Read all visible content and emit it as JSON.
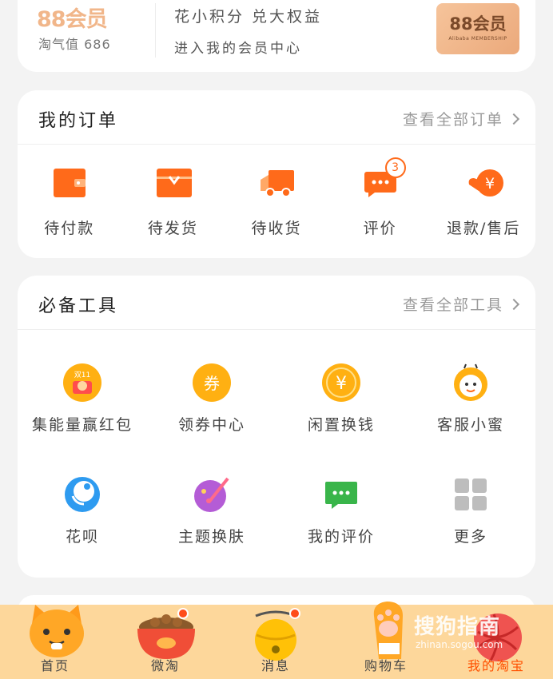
{
  "member": {
    "logo": "88会员",
    "value_text": "淘气值 686",
    "line1": "花小积分 兑大权益",
    "line2": "进入我的会员中心",
    "badge_title": "88会员",
    "badge_sub": "Alibaba MEMBERSHIP"
  },
  "orders": {
    "title": "我的订单",
    "view_all": "查看全部订单",
    "items": [
      {
        "label": "待付款",
        "icon": "wallet-icon"
      },
      {
        "label": "待发货",
        "icon": "package-icon"
      },
      {
        "label": "待收货",
        "icon": "truck-icon"
      },
      {
        "label": "评价",
        "icon": "comment-icon",
        "badge": "3"
      },
      {
        "label": "退款/售后",
        "icon": "refund-icon"
      }
    ]
  },
  "tools": {
    "title": "必备工具",
    "view_all": "查看全部工具",
    "items": [
      {
        "label": "集能量赢红包",
        "icon": "red-packet-icon",
        "badge_text": "双11"
      },
      {
        "label": "领券中心",
        "icon": "coupon-icon",
        "glyph": "券"
      },
      {
        "label": "闲置换钱",
        "icon": "yen-icon",
        "glyph": "¥"
      },
      {
        "label": "客服小蜜",
        "icon": "bee-icon"
      },
      {
        "label": "花呗",
        "icon": "huabei-icon"
      },
      {
        "label": "主题换肤",
        "icon": "palette-icon"
      },
      {
        "label": "我的评价",
        "icon": "chat-icon"
      },
      {
        "label": "更多",
        "icon": "grid-icon"
      }
    ]
  },
  "tabbar": {
    "items": [
      {
        "label": "首页"
      },
      {
        "label": "微淘"
      },
      {
        "label": "消息"
      },
      {
        "label": "购物车"
      },
      {
        "label": "我的淘宝"
      }
    ]
  },
  "watermark": {
    "text": "搜狗指南",
    "url": "zhinan.sogou.com"
  },
  "colors": {
    "accent": "#ff5000",
    "orange_icon": "#ff6a1a",
    "tabbar_bg": "#fdd79b"
  }
}
